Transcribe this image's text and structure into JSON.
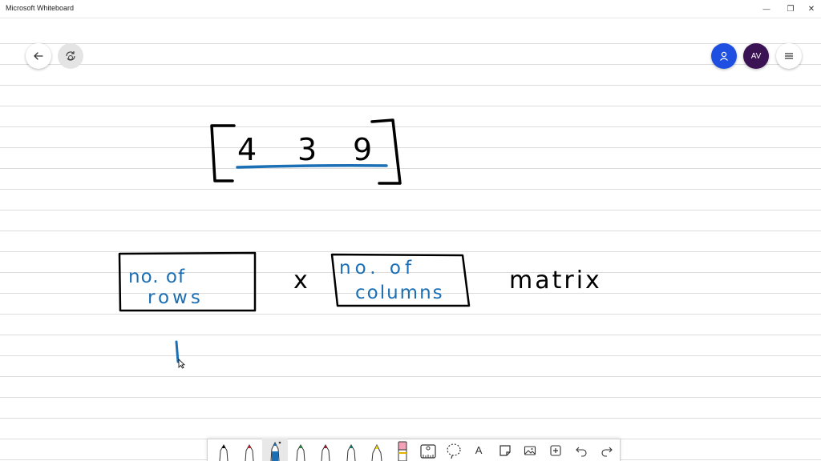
{
  "window": {
    "title": "Microsoft Whiteboard",
    "controls": {
      "minimize": "—",
      "restore": "❐",
      "close": "✕"
    }
  },
  "header": {
    "back_icon": "back-arrow-icon",
    "sync_icon": "sync-icon",
    "invite_icon": "person-icon",
    "avatar_initials": "AV",
    "menu_icon": "hamburger-icon"
  },
  "colors": {
    "ink_black": "#000000",
    "ink_blue": "#1a6fb5",
    "invite_blue": "#1f4fe0",
    "avatar_purple": "#3b1254",
    "gridline": "#dcdcdc"
  },
  "toolbar": {
    "tools": [
      {
        "icon": "pen-black-icon"
      },
      {
        "icon": "pen-red-icon"
      },
      {
        "icon": "pen-blue-icon",
        "selected": true
      },
      {
        "icon": "pen-green-icon"
      },
      {
        "icon": "pen-darkred-icon"
      },
      {
        "icon": "pen-teal-icon"
      },
      {
        "icon": "highlighter-yellow-icon"
      },
      {
        "icon": "eraser-icon"
      },
      {
        "icon": "ruler-icon"
      },
      {
        "icon": "lasso-icon"
      },
      {
        "icon": "text-icon",
        "label": "A"
      },
      {
        "icon": "sticky-note-icon"
      },
      {
        "icon": "image-icon"
      },
      {
        "icon": "insert-icon"
      },
      {
        "icon": "undo-icon"
      },
      {
        "icon": "redo-icon"
      }
    ]
  },
  "board": {
    "matrix_values": [
      "4",
      "3",
      "9"
    ],
    "box1_line1": "no. of",
    "box1_line2": "rows",
    "times_symbol": "x",
    "box2_line1": "no. of",
    "box2_line2": "columns",
    "trailing_word": "matrix",
    "rows_value": "1"
  }
}
